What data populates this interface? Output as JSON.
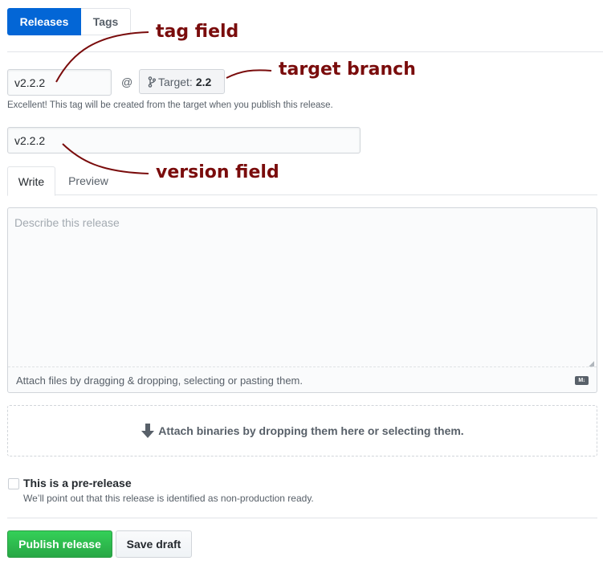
{
  "tabs": {
    "releases": "Releases",
    "tags": "Tags"
  },
  "tag_field": {
    "value": "v2.2.2"
  },
  "at_sign": "@",
  "target": {
    "label": "Target:",
    "branch": "2.2"
  },
  "hint": "Excellent! This tag will be created from the target when you publish this release.",
  "version_field": {
    "value": "v2.2.2"
  },
  "editor_tabs": {
    "write": "Write",
    "preview": "Preview"
  },
  "description": {
    "placeholder": "Describe this release"
  },
  "attach_text": "Attach files by dragging & dropping, selecting or pasting them.",
  "md_badge": "M↓",
  "dropzone_text": "Attach binaries by dropping them here or selecting them.",
  "prerelease": {
    "label": "This is a pre-release",
    "note": "We’ll point out that this release is identified as non-production ready."
  },
  "buttons": {
    "publish": "Publish release",
    "save_draft": "Save draft"
  },
  "annotations": {
    "tag": "tag field",
    "target": "target branch",
    "version": "version field"
  },
  "colors": {
    "primary": "#0366d6",
    "success": "#28a745",
    "annotation": "#7a0c0c"
  },
  "icons": {
    "branch": "git-branch-icon",
    "arrow": "arrow-down-icon",
    "markdown": "markdown-icon"
  }
}
